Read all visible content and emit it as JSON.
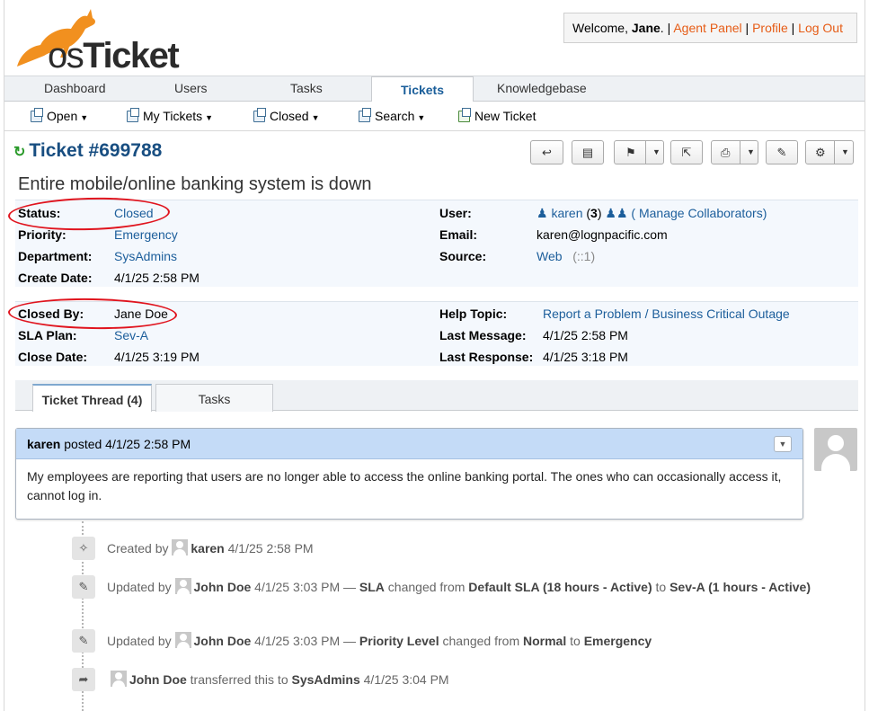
{
  "header": {
    "logo_text_os": "os",
    "logo_text_ticket": "Ticket",
    "welcome_prefix": "Welcome, ",
    "user_name": "Jane",
    "welcome_suffix": ".",
    "agent_panel": "Agent Panel",
    "profile": "Profile",
    "logout": "Log Out",
    "sep": "|"
  },
  "nav": {
    "tabs": [
      "Dashboard",
      "Users",
      "Tasks",
      "Tickets",
      "Knowledgebase"
    ],
    "active": "Tickets"
  },
  "subnav": {
    "open": "Open",
    "my_tickets": "My Tickets",
    "closed": "Closed",
    "search": "Search",
    "new_ticket": "New Ticket"
  },
  "ticket": {
    "title": "Ticket #699788",
    "subject": "Entire mobile/online banking system is down",
    "status_label": "Status:",
    "status": "Closed",
    "priority_label": "Priority:",
    "priority": "Emergency",
    "department_label": "Department:",
    "department": "SysAdmins",
    "create_date_label": "Create Date:",
    "create_date": "4/1/25 2:58 PM",
    "user_label": "User:",
    "user": "karen",
    "user_count": "3",
    "manage_collaborators": "( Manage Collaborators)",
    "email_label": "Email:",
    "email": "karen@lognpacific.com",
    "source_label": "Source:",
    "source": "Web",
    "source_ip": "(::1)",
    "closed_by_label": "Closed By:",
    "closed_by": "Jane Doe",
    "sla_label": "SLA Plan:",
    "sla": "Sev-A",
    "close_date_label": "Close Date:",
    "close_date": "4/1/25 3:19 PM",
    "help_topic_label": "Help Topic:",
    "help_topic": "Report a Problem / Business Critical Outage",
    "last_message_label": "Last Message:",
    "last_message": "4/1/25 2:58 PM",
    "last_response_label": "Last Response:",
    "last_response": "4/1/25 3:18 PM"
  },
  "thread_tabs": {
    "thread": "Ticket Thread (4)",
    "tasks": "Tasks"
  },
  "entry": {
    "author": "karen",
    "posted": " posted 4/1/25 2:58 PM",
    "body": "My employees are reporting that users are no longer able to access the online banking portal. The ones who can occasionally access it, cannot log in."
  },
  "events": [
    {
      "icon": "magic-wand-icon",
      "prefix": "Created by ",
      "who": "karen",
      "time": " 4/1/25 2:58 PM",
      "rest": ""
    },
    {
      "icon": "pencil-icon",
      "prefix": "Updated by ",
      "who": "John Doe",
      "time": " 4/1/25 3:03 PM",
      "dash": " — ",
      "field": "SLA",
      "changed": " changed from ",
      "from": "Default SLA (18 hours - Active)",
      "to_word": " to ",
      "to": "Sev-A (1 hours - Active)"
    },
    {
      "icon": "pencil-icon",
      "prefix": "Updated by ",
      "who": "John Doe",
      "time": " 4/1/25 3:03 PM",
      "dash": " — ",
      "field": "Priority Level",
      "changed": " changed from ",
      "from": "Normal",
      "to_word": " to ",
      "to": "Emergency"
    },
    {
      "icon": "share-arrow-icon",
      "who": "John Doe",
      "mid": " transferred this to ",
      "dept": "SysAdmins",
      "time": " 4/1/25 3:04 PM"
    }
  ],
  "colors": {
    "brand_orange": "#e65c16",
    "link_blue": "#1c5e9b",
    "annotation_red": "#e0141e"
  }
}
